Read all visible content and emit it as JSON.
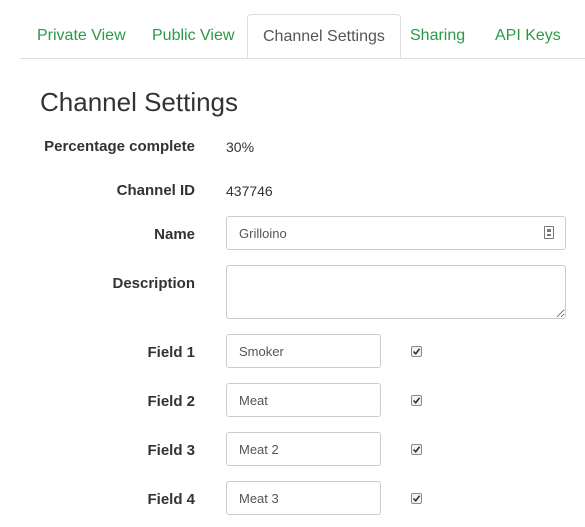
{
  "tabs": [
    {
      "label": "Private View",
      "active": false
    },
    {
      "label": "Public View",
      "active": false
    },
    {
      "label": "Channel Settings",
      "active": true
    },
    {
      "label": "Sharing",
      "active": false
    },
    {
      "label": "API Keys",
      "active": false
    }
  ],
  "page_title": "Channel Settings",
  "percentage": {
    "label": "Percentage complete",
    "value": "30%"
  },
  "channel_id": {
    "label": "Channel ID",
    "value": "437746"
  },
  "name": {
    "label": "Name",
    "value": "Grilloino"
  },
  "description": {
    "label": "Description",
    "value": ""
  },
  "fields": [
    {
      "label": "Field 1",
      "value": "Smoker",
      "checked": true
    },
    {
      "label": "Field 2",
      "value": "Meat",
      "checked": true
    },
    {
      "label": "Field 3",
      "value": "Meat 2",
      "checked": true
    },
    {
      "label": "Field 4",
      "value": "Meat 3",
      "checked": true
    }
  ],
  "colors": {
    "tab_link": "#2a9a45",
    "text": "#333333",
    "border": "#cccccc"
  },
  "icons": {
    "name_field": "contact-card-icon",
    "field_checkbox": "checkmark-icon"
  }
}
